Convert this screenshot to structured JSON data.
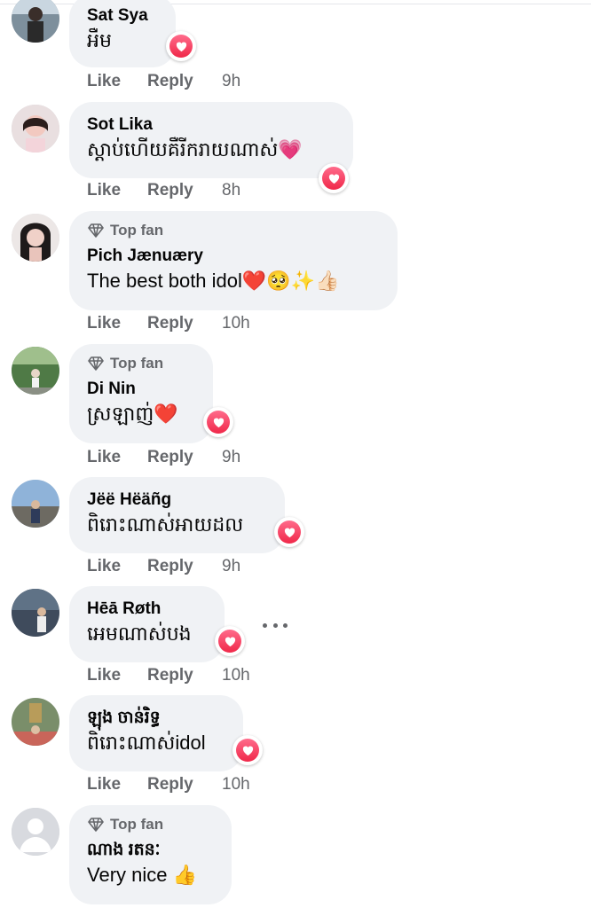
{
  "actions": {
    "like": "Like",
    "reply": "Reply"
  },
  "top_fan_label": "Top fan",
  "comments": [
    {
      "author": "Sat Sya",
      "text": "អឺម",
      "time": "9h",
      "top_fan": false
    },
    {
      "author": "Sot Lika",
      "text": "ស្តាប់ហើយគឺរីករាយណាស់💗",
      "time": "8h",
      "top_fan": false
    },
    {
      "author": "Pich Jænuæry",
      "text": "The best both idol❤️🥺✨👍🏻",
      "time": "10h",
      "top_fan": true
    },
    {
      "author": "Di Nin",
      "text": "ស្រឡាញ់❤️",
      "time": "9h",
      "top_fan": true
    },
    {
      "author": "Jëë Hëäñg",
      "text": "ពិរោះណាស់អាយដល",
      "time": "9h",
      "top_fan": false
    },
    {
      "author": "Hēā Røth",
      "text": "អេមណាស់បង",
      "time": "10h",
      "top_fan": false
    },
    {
      "author": "ឡុង ចាន់រិទ្ធ",
      "text": "ពិរោះណាស់idol",
      "time": "10h",
      "top_fan": false
    },
    {
      "author": "ណាង រតនៈ",
      "text": "Very nice 👍",
      "time": "",
      "top_fan": true
    }
  ],
  "colors": {
    "bubble": "#f0f2f5",
    "secondary_text": "#65676b",
    "reaction_heart": "#f02849"
  },
  "icons": {
    "reaction": "heart-icon",
    "top_fan": "diamond-icon",
    "more": "more-options-icon"
  }
}
